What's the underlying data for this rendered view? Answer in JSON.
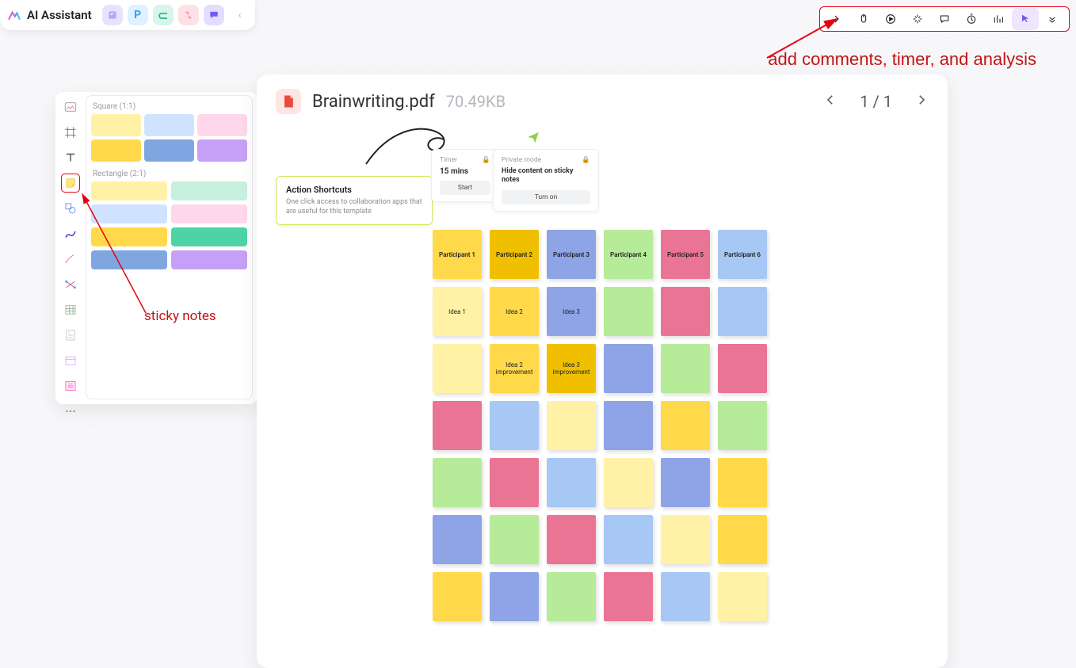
{
  "app_bar": {
    "title": "AI Assistant"
  },
  "annotations": {
    "right": "add comments, timer, and analysis",
    "left": "sticky notes"
  },
  "palette": {
    "square_label": "Square (1:1)",
    "rect_label": "Rectangle (2:1)",
    "square_colors": [
      "#fff2a6",
      "#cfe3ff",
      "#ffd7ea",
      "#ffd94a",
      "#7fa6e0",
      "#c6a0f6"
    ],
    "rect_colors": [
      "#fff2a6",
      "#c7f0de",
      "#cfe3ff",
      "#ffd7ea",
      "#ffd94a",
      "#4dd4a5",
      "#7fa6e0",
      "#c6a0f6"
    ]
  },
  "doc": {
    "title": "Brainwriting.pdf",
    "size": "70.49KB",
    "page": "1 / 1"
  },
  "cards": {
    "action": {
      "title": "Action Shortcuts",
      "sub": "One click access to collaboration apps that are useful for this template"
    },
    "timer": {
      "hdr": "Timer",
      "value": "15 mins",
      "cta": "Start"
    },
    "private": {
      "hdr": "Private mode",
      "value": "Hide content on sticky notes",
      "cta": "Turn on"
    }
  },
  "notes": [
    [
      "Participant 1",
      "#ffd94a"
    ],
    [
      "Participant 2",
      "#f0c000"
    ],
    [
      "Participant 3",
      "#8ea4e6"
    ],
    [
      "Participant 4",
      "#b6eb9a"
    ],
    [
      "Participant 5",
      "#ea7494"
    ],
    [
      "Participant 6",
      "#a7c7f5"
    ],
    [
      "Idea 1",
      "#fff2a6"
    ],
    [
      "Idea 2",
      "#ffd94a"
    ],
    [
      "Idea 3",
      "#8ea4e6"
    ],
    [
      "",
      "#b6eb9a"
    ],
    [
      "",
      "#ea7494"
    ],
    [
      "",
      "#a7c7f5"
    ],
    [
      "",
      "#fff2a6"
    ],
    [
      "Idea 2 improvement",
      "#ffd94a"
    ],
    [
      "Idea 3 improvement",
      "#f0c000"
    ],
    [
      "",
      "#8ea4e6"
    ],
    [
      "",
      "#b6eb9a"
    ],
    [
      "",
      "#ea7494"
    ],
    [
      "",
      "#ea7494"
    ],
    [
      "",
      "#a7c7f5"
    ],
    [
      "",
      "#fff2a6"
    ],
    [
      "",
      "#8ea4e6"
    ],
    [
      "",
      "#ffd94a"
    ],
    [
      "",
      "#b6eb9a"
    ],
    [
      "",
      "#b6eb9a"
    ],
    [
      "",
      "#ea7494"
    ],
    [
      "",
      "#a7c7f5"
    ],
    [
      "",
      "#fff2a6"
    ],
    [
      "",
      "#8ea4e6"
    ],
    [
      "",
      "#ffd94a"
    ],
    [
      "",
      "#8ea4e6"
    ],
    [
      "",
      "#b6eb9a"
    ],
    [
      "",
      "#ea7494"
    ],
    [
      "",
      "#a7c7f5"
    ],
    [
      "",
      "#fff2a6"
    ],
    [
      "",
      "#ffd94a"
    ],
    [
      "",
      "#ffd94a"
    ],
    [
      "",
      "#8ea4e6"
    ],
    [
      "",
      "#b6eb9a"
    ],
    [
      "",
      "#ea7494"
    ],
    [
      "",
      "#a7c7f5"
    ],
    [
      "",
      "#fff2a6"
    ]
  ]
}
